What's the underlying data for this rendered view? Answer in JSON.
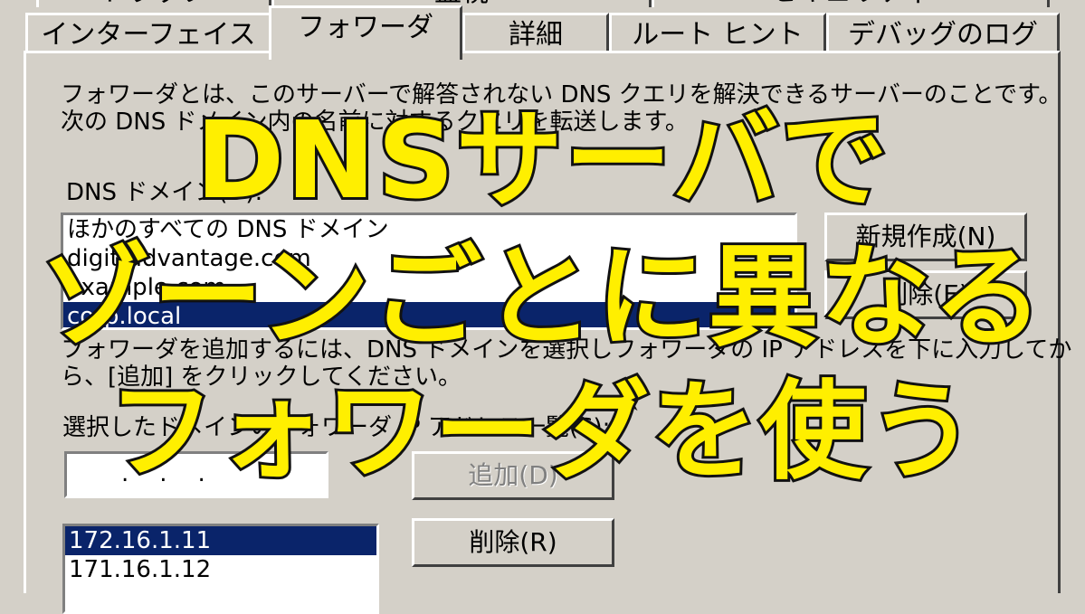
{
  "tabs_top": [
    "トラップ",
    "監視",
    "セキュリティ"
  ],
  "tabs": [
    {
      "label": "インターフェイス",
      "active": false
    },
    {
      "label": "フォワーダ",
      "active": true
    },
    {
      "label": "詳細",
      "active": false
    },
    {
      "label": "ルート ヒント",
      "active": false
    },
    {
      "label": "デバッグのログ",
      "active": false
    }
  ],
  "panel": {
    "description_line1": "フォワーダとは、このサーバーで解答されない DNS クエリを解決できるサーバーのことです。",
    "description_line2": "次の DNS ドメイン内の名前に対するクエリを転送します。",
    "domain_label": "DNS ドメイン(D):",
    "domains": [
      {
        "name": "ほかのすべての DNS ドメイン",
        "selected": false
      },
      {
        "name": "digit-advantage.com",
        "selected": false
      },
      {
        "name": "example.com",
        "selected": false
      },
      {
        "name": "corp.local",
        "selected": true
      }
    ],
    "new_button": "新規作成(N)",
    "delete_domain_button": "削除(E)",
    "instructions_line1": "フォワーダを追加するには、DNS ドメインを選択しフォワーダの IP アドレスを下に入力してか",
    "instructions_line2": "ら、[追加] をクリックしてください。",
    "ip_list_label": "選択したドメインのフォワーダ IP アドレス一覧(S):",
    "ip_input_value": "...",
    "add_button": "追加(D)",
    "ip_addresses": [
      {
        "ip": "172.16.1.11",
        "selected": true
      },
      {
        "ip": "171.16.1.12",
        "selected": false
      }
    ],
    "remove_button": "削除(R)"
  },
  "headline": {
    "line1": "DNSサーバで",
    "line2": "ゾーンごとに異なる",
    "line3": "フォワーダを使う"
  },
  "colors": {
    "headline_fill": "#ffef00",
    "headline_stroke": "#111111",
    "selection": "#0a246a",
    "window_bg": "#d4d0c8"
  }
}
